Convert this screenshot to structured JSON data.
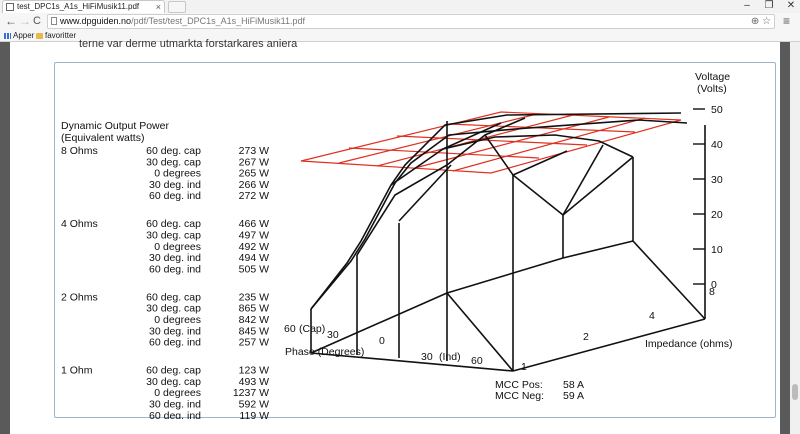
{
  "browser": {
    "tab_title": "test_DPC1s_A1s_HiFiMusik11.pdf",
    "tab_close": "×",
    "window_controls": [
      "–",
      "❐",
      "✕"
    ],
    "nav": {
      "back": "←",
      "forward": "→",
      "reload": "C"
    },
    "url_domain": "www.dpguiden.no",
    "url_path": "/pdf/Test/test_DPC1s_A1s_HiFiMusik11.pdf",
    "menu": "≡"
  },
  "bookmarks": [
    {
      "label": "Apper",
      "icon": "apps-grid-icon"
    },
    {
      "label": "favoritter",
      "icon": "folder-icon"
    }
  ],
  "pdf": {
    "cut_text": "terne var derme utmarkta forstarkares aniera",
    "table": {
      "title": "Dynamic Output Power",
      "subtitle": "(Equivalent watts)",
      "groups": [
        {
          "load": "8 Ohms",
          "rows": [
            {
              "phase": "60 deg. cap",
              "value": "273 W"
            },
            {
              "phase": "30 deg. cap",
              "value": "267 W"
            },
            {
              "phase": "0 degrees",
              "value": "265 W"
            },
            {
              "phase": "30 deg. ind",
              "value": "266 W"
            },
            {
              "phase": "60 deg. ind",
              "value": "272 W"
            }
          ]
        },
        {
          "load": "4 Ohms",
          "rows": [
            {
              "phase": "60 deg. cap",
              "value": "466 W"
            },
            {
              "phase": "30 deg. cap",
              "value": "497 W"
            },
            {
              "phase": "0 degrees",
              "value": "492 W"
            },
            {
              "phase": "30 deg. ind",
              "value": "494 W"
            },
            {
              "phase": "60 deg. ind",
              "value": "505 W"
            }
          ]
        },
        {
          "load": "2 Ohms",
          "rows": [
            {
              "phase": "60 deg. cap",
              "value": "235 W"
            },
            {
              "phase": "30 deg. cap",
              "value": "865 W"
            },
            {
              "phase": "0 degrees",
              "value": "842 W"
            },
            {
              "phase": "30 deg. ind",
              "value": "845 W"
            },
            {
              "phase": "60 deg. ind",
              "value": "257 W"
            }
          ]
        },
        {
          "load": "1 Ohm",
          "rows": [
            {
              "phase": "60 deg. cap",
              "value": "123 W"
            },
            {
              "phase": "30 deg. cap",
              "value": "493 W"
            },
            {
              "phase": "0 degrees",
              "value": "1237 W"
            },
            {
              "phase": "30 deg. ind",
              "value": "592 W"
            },
            {
              "phase": "60 deg. ind",
              "value": "119 W"
            }
          ]
        }
      ]
    },
    "chart": {
      "voltage_title": "Voltage",
      "voltage_unit": "(Volts)",
      "voltage_ticks": [
        "50",
        "40",
        "30",
        "20",
        "10",
        "0"
      ],
      "phase_title": "Phase (Degrees)",
      "phase_ticks": [
        "60",
        "(Cap)",
        "30",
        "0",
        "30",
        "(Ind)",
        "60"
      ],
      "impedance_title": "Impedance (ohms)",
      "impedance_ticks": [
        "1",
        "2",
        "4",
        "8"
      ],
      "mcc": [
        {
          "label": "MCC Pos:",
          "value": "58 A"
        },
        {
          "label": "MCC Neg:",
          "value": "59 A"
        }
      ],
      "colors": {
        "surface": "#111111",
        "reference_grid": "#e03020"
      }
    }
  }
}
